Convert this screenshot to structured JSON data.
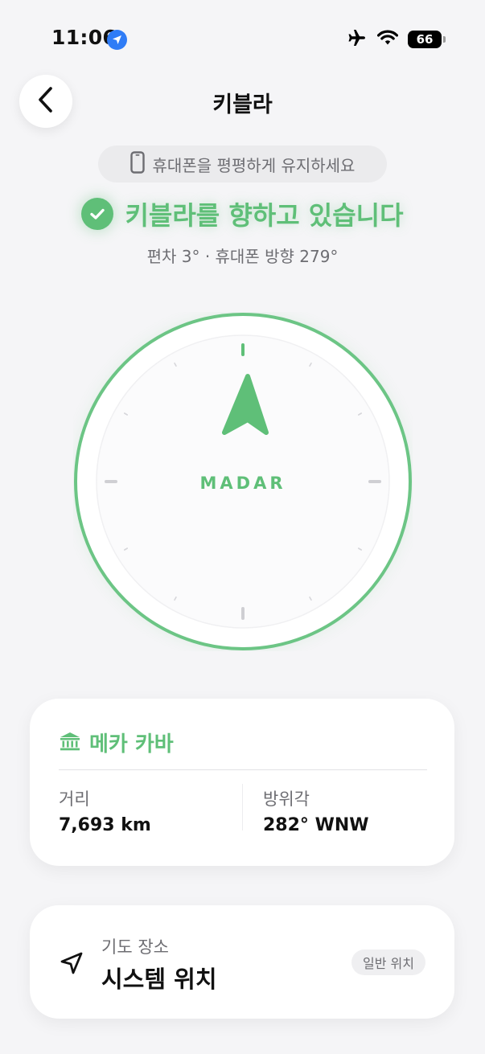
{
  "status_bar": {
    "time": "11:06",
    "battery": "66",
    "icons": [
      "location-arrow-icon",
      "airplane-icon",
      "wifi-icon",
      "battery-icon"
    ]
  },
  "header": {
    "title": "키블라",
    "back_icon": "chevron-left-icon"
  },
  "hint": {
    "icon": "phone-icon",
    "text": "휴대폰을 평평하게 유지하세요"
  },
  "status": {
    "icon": "check-circle-icon",
    "text": "키블라를 향하고 있습니다",
    "deviation": "편차 3° · 휴대폰 방향 279°"
  },
  "compass": {
    "label": "MADAR",
    "needle_icon": "qibla-arrow-icon"
  },
  "mecca_card": {
    "icon": "kaaba-icon",
    "name": "메카 카바",
    "distance_label": "거리",
    "distance_value": "7,693 km",
    "bearing_label": "방위각",
    "bearing_value": "282° WNW"
  },
  "prayer_location": {
    "icon": "navigation-arrow-icon",
    "label": "기도 장소",
    "value": "시스템 위치",
    "badge": "일반 위치"
  },
  "colors": {
    "accent": "#5fbf78",
    "background": "#f5f5f7",
    "card": "#ffffff",
    "secondary_text": "#6d6d72"
  }
}
